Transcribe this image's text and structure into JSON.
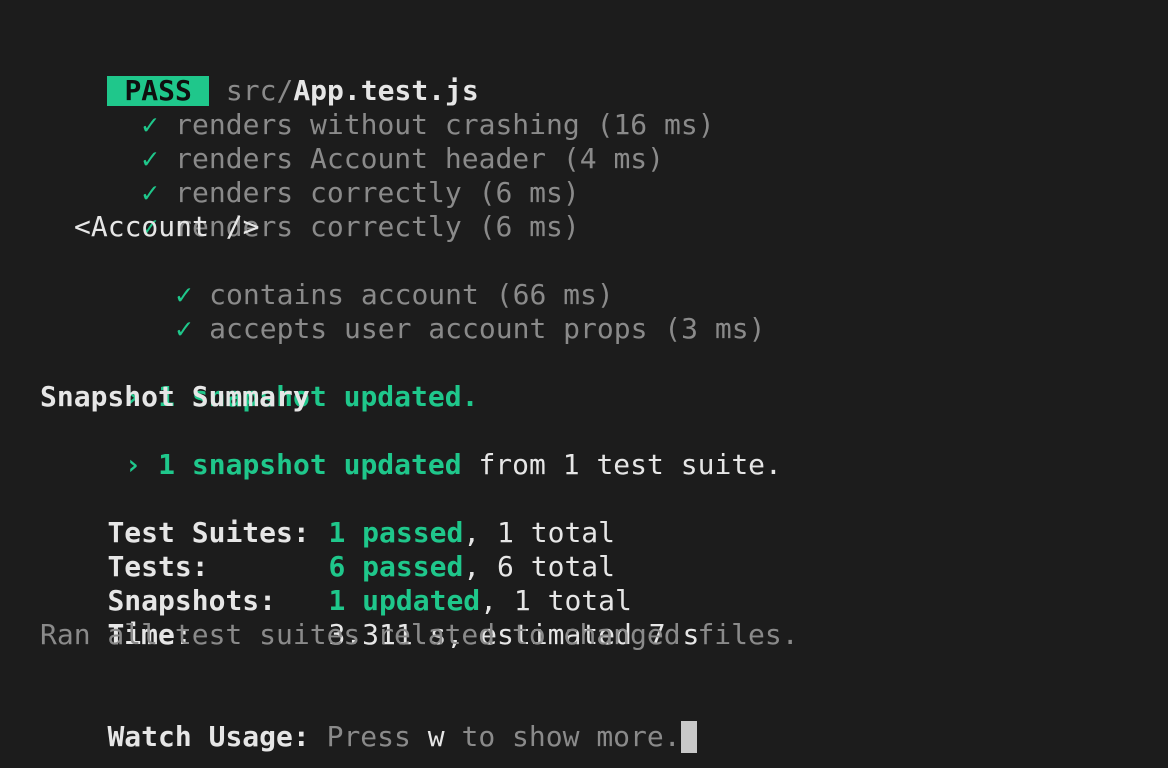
{
  "header": {
    "badge": "PASS",
    "path_prefix": "src/",
    "file": "App.test.js"
  },
  "tests": [
    {
      "check": "✓",
      "text": "renders without crashing (16 ms)"
    },
    {
      "check": "✓",
      "text": "renders Account header (4 ms)"
    },
    {
      "check": "✓",
      "text": "renders correctly (6 ms)"
    },
    {
      "check": "✓",
      "text": "renders correctly (6 ms)"
    }
  ],
  "describe": {
    "title": "<Account />",
    "tests": [
      {
        "check": "✓",
        "text": "contains account (66 ms)"
      },
      {
        "check": "✓",
        "text": "accepts user account props (3 ms)"
      }
    ]
  },
  "snapshot_notice": {
    "arrow": "›",
    "text": "1 snapshot updated."
  },
  "snapshot_summary": {
    "title": "Snapshot Summary",
    "arrow": "›",
    "highlight": "1 snapshot updated",
    "rest": " from 1 test suite."
  },
  "results": {
    "suites": {
      "label": "Test Suites:",
      "highlight": "1 passed",
      "rest": ", 1 total"
    },
    "tests": {
      "label": "Tests:",
      "highlight": "6 passed",
      "rest": ", 6 total"
    },
    "snapshots": {
      "label": "Snapshots:",
      "highlight": "1 updated",
      "rest": ", 1 total"
    },
    "time": {
      "label": "Time:",
      "value": "3.311 s, estimated 7 s"
    },
    "ran_all": "Ran all test suites related to changed files."
  },
  "watch": {
    "label": "Watch Usage:",
    "pre": " Press ",
    "key": "w",
    "post": " to show more."
  },
  "colors": {
    "background": "#1c1c1c",
    "accent_green": "#1fc78b",
    "dim_text": "#8a8a8a",
    "text": "#d6d6d6"
  }
}
